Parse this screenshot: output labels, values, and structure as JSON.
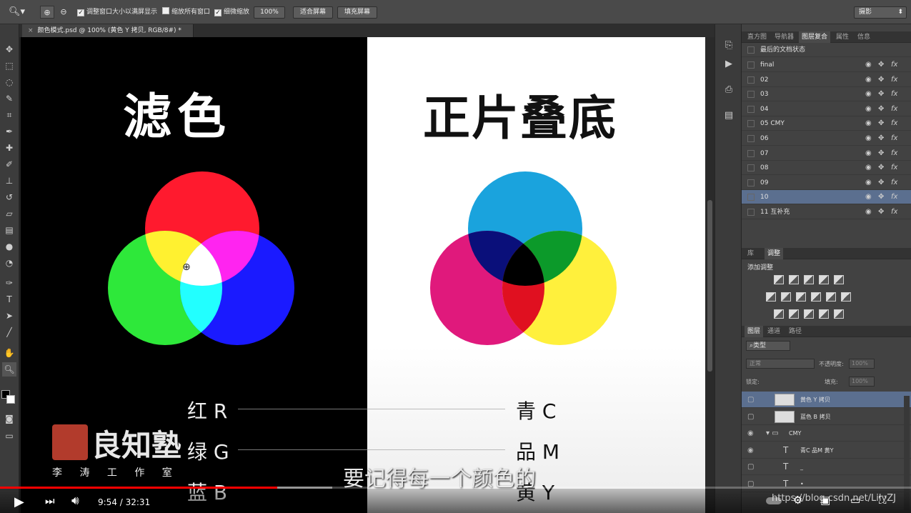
{
  "options_bar": {
    "resize_window_label": "调整窗口大小以满屏显示",
    "zoom_all_label": "缩放所有窗口",
    "scrubby_label": "细微缩放",
    "zoom_value": "100%",
    "fit_screen_label": "适合屏幕",
    "fill_screen_label": "填充屏幕",
    "workspace": "摄影"
  },
  "document": {
    "tab_title": "颜色模式.psd @ 100% (黄色 Y 拷贝, RGB/8#) *"
  },
  "canvas": {
    "left_title": "滤色",
    "right_title": "正片叠底",
    "left_labels": [
      "红 R",
      "绿 G",
      "蓝 B"
    ],
    "right_labels": [
      "青 C",
      "品 M",
      "黄 Y"
    ],
    "colors": {
      "red": "#ff1a2e",
      "green": "#2ee83a",
      "blue": "#1a1aff",
      "yellow": "#fff130",
      "magenta": "#ff24f0",
      "cyan": "#22ffff",
      "white": "#ffffff",
      "c_cyan": "#1aa3dd",
      "c_magenta": "#e0197c",
      "c_yellow": "#fff03c",
      "c_navy": "#0a0f7a",
      "c_green": "#0c9a2a",
      "c_red": "#e01020",
      "c_black": "#000000"
    }
  },
  "watermark": {
    "seal_text": "良知塾",
    "studio_text": "李 涛 工 作 室"
  },
  "history_panel": {
    "tabs": [
      "直方图",
      "导航器",
      "图层复合",
      "属性",
      "信息"
    ],
    "active_tab": "图层复合",
    "header_row": "最后的文档状态",
    "rows": [
      "final",
      "02",
      "03",
      "04",
      "05 CMY",
      "06",
      "07",
      "08",
      "09",
      "10",
      "11 互补充"
    ],
    "selected_row": "10"
  },
  "adjust_panel": {
    "tabs": [
      "库",
      "调整"
    ],
    "active_tab": "调整",
    "add_label": "添加调整"
  },
  "layers_panel": {
    "tabs": [
      "图层",
      "通道",
      "路径"
    ],
    "active_tab": "图层",
    "filter_label": "类型",
    "blend_mode": "正常",
    "opacity_label": "不透明度:",
    "opacity_value": "100%",
    "lock_label": "锁定:",
    "fill_label": "填充:",
    "fill_value": "100%",
    "layers": [
      {
        "name": "黄色 Y 拷贝",
        "kind": "thumb",
        "selected": true
      },
      {
        "name": "蓝色 B 拷贝",
        "kind": "thumb",
        "selected": false
      },
      {
        "name": "CMY",
        "kind": "folder",
        "selected": false
      },
      {
        "name": "青C 品M 黄Y",
        "kind": "text",
        "selected": false
      },
      {
        "name": "_",
        "kind": "text",
        "selected": false
      },
      {
        "name": "•",
        "kind": "text",
        "selected": false
      }
    ]
  },
  "video": {
    "subtitle": "要记得每一个颜色的",
    "current_time": "9:54",
    "duration": "32:31",
    "time_display": "9:54 / 32:31",
    "progress": 0.304,
    "buffered": 0.365,
    "url_watermark": "https://blog.csdn.net/LilyZJ"
  }
}
